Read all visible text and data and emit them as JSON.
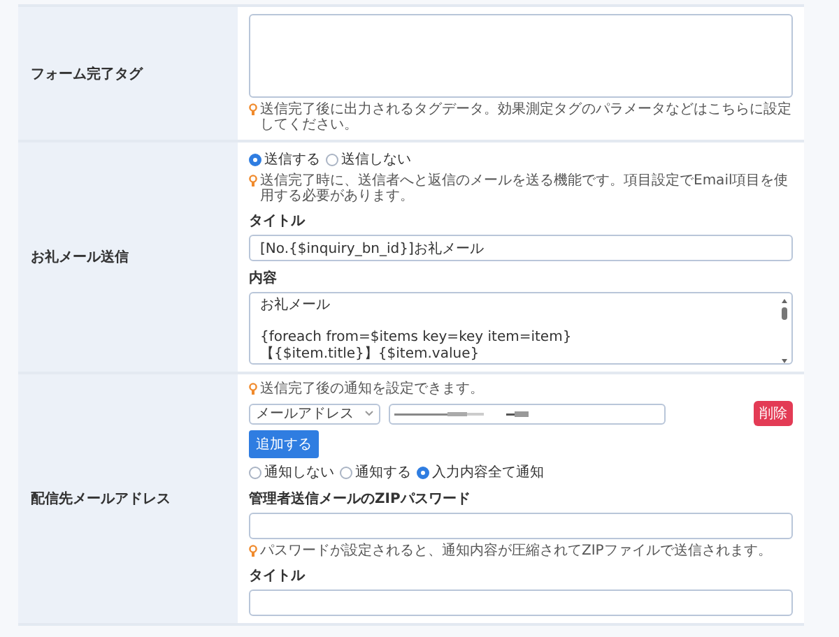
{
  "rows": [
    {
      "label": "フォーム完了タグ",
      "fields": [
        {
          "kind": "textarea"
        },
        {
          "kind": "hint",
          "text": "送信完了後に出力されるタグデータ。効果測定タグのパラメータなどはこちらに設定してください。"
        }
      ]
    },
    {
      "label": "お礼メール送信",
      "fields": [
        {
          "kind": "radios",
          "options": [
            {
              "label": "送信する",
              "selected": true
            },
            {
              "label": "送信しない",
              "selected": false
            }
          ]
        },
        {
          "kind": "hint",
          "text": "送信完了時に、送信者へと返信のメールを送る機能です。項目設定でEmail項目を使用する必要があります。"
        },
        {
          "kind": "label",
          "text": "タイトル"
        },
        {
          "kind": "input",
          "value": "[No.{$inquiry_bn_id}]お礼メール"
        },
        {
          "kind": "label",
          "text": "内容"
        },
        {
          "kind": "textarea",
          "paragraphs": [
            [
              "お礼メール"
            ],
            [
              "{foreach from=$items key=key item=item}",
              "【{$item.title}】{$item.value}"
            ]
          ]
        }
      ]
    },
    {
      "label": "配信先メールアドレス",
      "fields": [
        {
          "kind": "hint",
          "text": "送信完了後の通知を設定できます。"
        },
        {
          "kind": "address",
          "select": "メールアドレス",
          "delete": "削除"
        },
        {
          "kind": "button",
          "text": "追加する"
        },
        {
          "kind": "radios",
          "options": [
            {
              "label": "通知しない",
              "selected": false
            },
            {
              "label": "通知する",
              "selected": false
            },
            {
              "label": "入力内容全て通知",
              "selected": true
            }
          ]
        },
        {
          "kind": "label",
          "text": "管理者送信メールのZIPパスワード"
        },
        {
          "kind": "input"
        },
        {
          "kind": "hint",
          "text": "パスワードが設定されると、通知内容が圧縮されてZIPファイルで送信されます。"
        },
        {
          "kind": "label",
          "text": "タイトル"
        },
        {
          "kind": "input"
        }
      ]
    }
  ]
}
